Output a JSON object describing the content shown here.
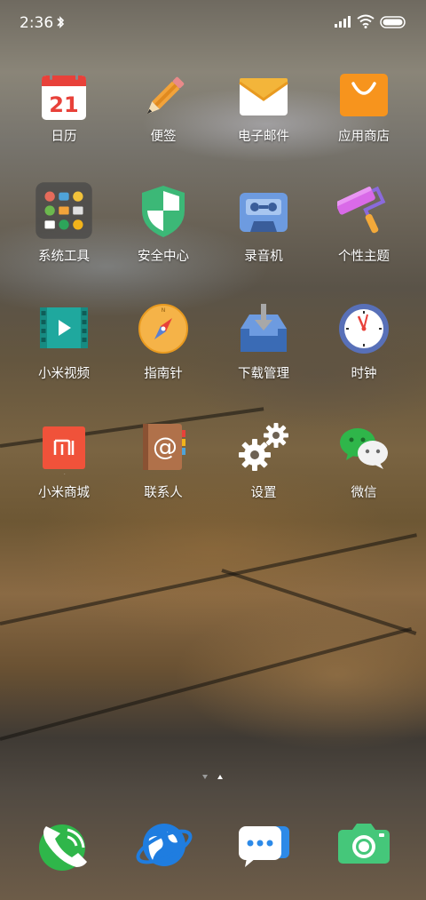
{
  "status_bar": {
    "time": "2:36",
    "icons": [
      "bluetooth-icon",
      "signal-icon",
      "wifi-icon",
      "battery-icon"
    ]
  },
  "home_apps": [
    {
      "label": "日历",
      "icon": "calendar-icon",
      "date": "21"
    },
    {
      "label": "便签",
      "icon": "pencil-icon"
    },
    {
      "label": "电子邮件",
      "icon": "mail-icon"
    },
    {
      "label": "应用商店",
      "icon": "shopping-bag-icon"
    },
    {
      "label": "系统工具",
      "icon": "folder-icon"
    },
    {
      "label": "安全中心",
      "icon": "shield-icon"
    },
    {
      "label": "录音机",
      "icon": "cassette-icon"
    },
    {
      "label": "个性主题",
      "icon": "paint-roller-icon"
    },
    {
      "label": "小米视频",
      "icon": "video-icon"
    },
    {
      "label": "指南针",
      "icon": "compass-icon"
    },
    {
      "label": "下载管理",
      "icon": "download-tray-icon"
    },
    {
      "label": "时钟",
      "icon": "clock-icon"
    },
    {
      "label": "小米商城",
      "icon": "mi-store-icon",
      "logo_text": "mi"
    },
    {
      "label": "联系人",
      "icon": "contacts-book-icon"
    },
    {
      "label": "设置",
      "icon": "gear-icon"
    },
    {
      "label": "微信",
      "icon": "wechat-icon"
    }
  ],
  "page_indicator": {
    "pages": 2,
    "current": 2
  },
  "dock": [
    {
      "icon": "phone-icon"
    },
    {
      "icon": "browser-globe-icon"
    },
    {
      "icon": "messages-icon"
    },
    {
      "icon": "camera-icon"
    }
  ]
}
